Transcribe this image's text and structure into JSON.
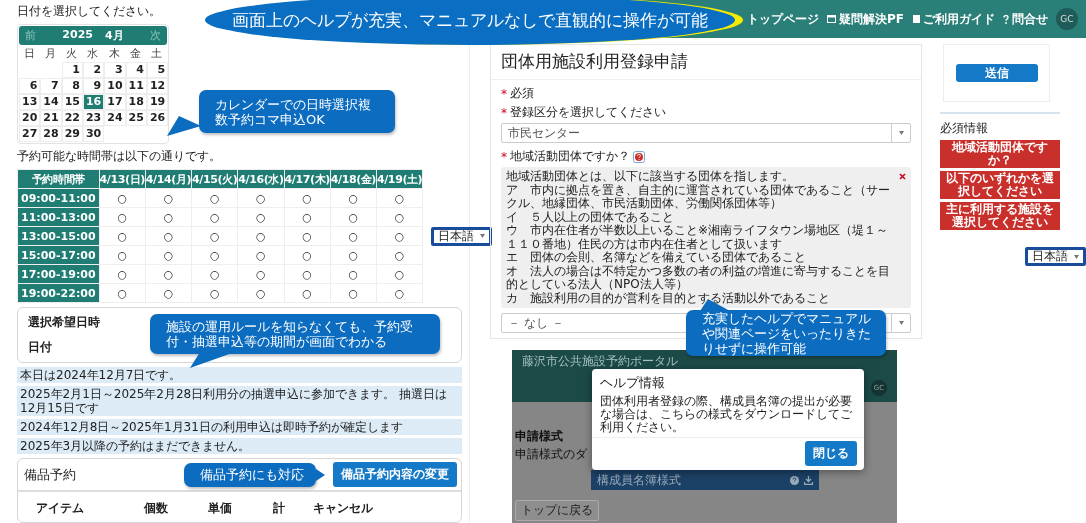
{
  "banner": {
    "text": "画面上のヘルプが充実、マニュアルなしで直観的に操作が可能"
  },
  "callouts": [
    {
      "text": "カレンダーでの日時選択複数予約コマ申込OK"
    },
    {
      "text": "施設の運用ルールを知らなくても、予約受付・抽選申込等の期間が画面でわかる"
    },
    {
      "text": "備品予約にも対応"
    },
    {
      "text": "充実したヘルプでマニュアルや関連ページをいったりきたりせずに操作可能"
    }
  ],
  "calendar_page": {
    "instruction": "日付を選択してください。",
    "calendar": {
      "prev": "前",
      "year": "2025",
      "month": "4月",
      "next": "次",
      "weekdays": [
        "日",
        "月",
        "火",
        "水",
        "木",
        "金",
        "土"
      ],
      "weeks": [
        [
          {
            "day": "1",
            "selected": false
          },
          {
            "day": "2",
            "selected": false
          },
          {
            "day": "3",
            "selected": false
          },
          {
            "day": "4",
            "selected": false
          },
          {
            "day": "5",
            "selected": false
          }
        ],
        [
          {
            "day": "6",
            "selected": false
          },
          {
            "day": "7",
            "selected": false
          },
          {
            "day": "8",
            "selected": false
          },
          {
            "day": "9",
            "selected": false
          },
          {
            "day": "10",
            "selected": false
          },
          {
            "day": "11",
            "selected": false
          },
          {
            "day": "12",
            "selected": false
          }
        ],
        [
          {
            "day": "13",
            "selected": false
          },
          {
            "day": "14",
            "selected": false
          },
          {
            "day": "15",
            "selected": false
          },
          {
            "day": "16",
            "selected": true
          },
          {
            "day": "17",
            "selected": false
          },
          {
            "day": "18",
            "selected": false
          },
          {
            "day": "19",
            "selected": false
          }
        ],
        [
          {
            "day": "20",
            "selected": false
          },
          {
            "day": "21",
            "selected": false
          },
          {
            "day": "22",
            "selected": false
          },
          {
            "day": "23",
            "selected": false
          },
          {
            "day": "24",
            "selected": false
          },
          {
            "day": "25",
            "selected": false
          },
          {
            "day": "26",
            "selected": false
          }
        ],
        [
          {
            "day": "27",
            "selected": false
          },
          {
            "day": "28",
            "selected": false
          },
          {
            "day": "29",
            "selected": false
          },
          {
            "day": "30",
            "selected": false
          }
        ]
      ]
    },
    "slots_note": "予約可能な時間帯は以下の通りです。",
    "slots_table": {
      "columns": [
        "予約時間帯",
        "4/13(日)",
        "4/14(月)",
        "4/15(火)",
        "4/16(水)",
        "4/17(木)",
        "4/18(金)",
        "4/19(土)"
      ],
      "rows": [
        {
          "cells": [
            "09:00-11:00",
            "○",
            "○",
            "○",
            "○",
            "○",
            "○",
            "○"
          ]
        },
        {
          "cells": [
            "11:00-13:00",
            "○",
            "○",
            "○",
            "○",
            "○",
            "○",
            "○"
          ]
        },
        {
          "cells": [
            "13:00-15:00",
            "○",
            "○",
            "○",
            "○",
            "○",
            "○",
            "○"
          ]
        },
        {
          "cells": [
            "15:00-17:00",
            "○",
            "○",
            "○",
            "○",
            "○",
            "○",
            "○"
          ]
        },
        {
          "cells": [
            "17:00-19:00",
            "○",
            "○",
            "○",
            "○",
            "○",
            "○",
            "○"
          ]
        },
        {
          "cells": [
            "19:00-22:00",
            "○",
            "○",
            "○",
            "○",
            "○",
            "○",
            "○"
          ]
        }
      ]
    },
    "language_select": "日本語",
    "selection_card": {
      "title": "選択希望日時",
      "date_label": "日付"
    },
    "notices": [
      "本日は2024年12月7日です。",
      "2025年2月1日～2025年2月28日利用分の抽選申込に参加できます。 抽選日は12月15日です",
      "2024年12月8日～2025年1月31日の利用申込は即時予約が確定します",
      "2025年3月以降の予約はまだできません。"
    ],
    "equipment_card": {
      "title": "備品予約",
      "change_button": "備品予約内容の変更",
      "columns": [
        "アイテム",
        "個数",
        "単価",
        "計",
        "キャンセル"
      ]
    }
  },
  "form_page": {
    "nav": [
      {
        "label": "トップページ"
      },
      {
        "label": "疑問解決PF"
      },
      {
        "label": "ご利用ガイド"
      },
      {
        "label": "問合せ"
      }
    ],
    "avatar": "GC",
    "title": "団体用施設利用登録申請",
    "required_note": {
      "mark": "*",
      "text": "必須"
    },
    "fields": [
      {
        "mark": "*",
        "label": "登録区分を選択してください",
        "value": "市民センター",
        "help": false
      },
      {
        "mark": "*",
        "label": "地域活動団体ですか？",
        "help": true,
        "value": "－ なし －",
        "help_lines": [
          "地域活動団体とは、以下に該当する団体を指します。",
          "ア　市内に拠点を置き、自主的に運営されている団体であること（サークル、地縁団体、市民活動団体、労働関係団体等）",
          "イ　５人以上の団体であること",
          "ウ　市内在住者が半数以上いること※湘南ライフタウン場地区（堤１～１１０番地）住民の方は市内在住者として扱います",
          "エ　団体の会則、名簿などを備えている団体であること",
          "オ　法人の場合は不特定かつ多数の者の利益の増進に寄与することを目的としている法人（NPO法人等）",
          "カ　施設利用の目的が営利を目的とする活動以外であること"
        ]
      }
    ],
    "submit_button": "送信",
    "required_info_title": "必須情報",
    "required_items": [
      "地域活動団体ですか？",
      "以下のいずれかを選択してください",
      "主に利用する施設を選択してください"
    ],
    "language_select": "日本語"
  },
  "portal_page": {
    "title": "藤沢市公共施設予約ポータル",
    "avatar": "GC",
    "heading": "申請様式",
    "subheading": "申請様式のダ",
    "download_item": "構成員名簿様式",
    "back_button": "トップに戻る",
    "dialog": {
      "title": "ヘルプ情報",
      "body": "団体利用者登録の際、構成員名簿の提出が必要な場合は、こちらの様式をダウンロードしてご利用ください。",
      "close_button": "閉じる"
    }
  }
}
